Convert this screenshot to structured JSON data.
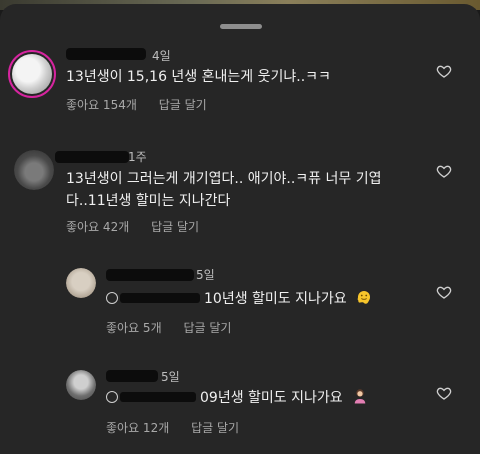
{
  "comments": [
    {
      "time": "4일",
      "text": "13년생이 15,16 년생 혼내는게 웃기냐..ㅋㅋ",
      "likes": "좋아요 154개",
      "reply": "답글 달기"
    },
    {
      "time": "1주",
      "text_line1": "13년생이 그러는게 개기엽다.. 애기야..ㅋ퓨 너무 기엽",
      "text_line2": "다..11년생 할미는 지나간다",
      "likes": "좋아요 42개",
      "reply": "답글 달기"
    },
    {
      "time": "5일",
      "text": "10년생 할미도 지나가요",
      "likes": "좋아요 5개",
      "reply": "답글 달기",
      "emoji": "melting-face-emoji"
    },
    {
      "time": "5일",
      "text": "09년생 할미도 지나가요",
      "likes": "좋아요 12개",
      "reply": "답글 달기",
      "emoji": "woman-gesturing-emoji"
    }
  ],
  "colors": {
    "sheet": "#262626",
    "secondary_text": "#a8a8a8",
    "story_ring": "#d6249f"
  }
}
